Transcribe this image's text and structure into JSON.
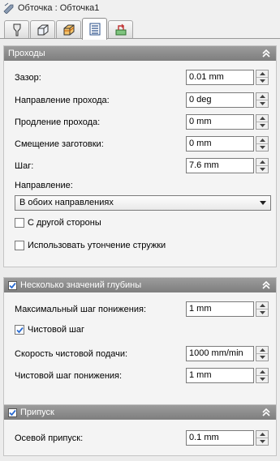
{
  "window": {
    "title": "Обточка : Обточка1"
  },
  "tabs": [
    {
      "name": "tool",
      "icon": "tool-icon"
    },
    {
      "name": "geometry",
      "icon": "geometry-icon"
    },
    {
      "name": "heights",
      "icon": "heights-icon"
    },
    {
      "name": "passes",
      "icon": "passes-icon",
      "active": true
    },
    {
      "name": "linking",
      "icon": "linking-icon"
    }
  ],
  "passes": {
    "title": "Проходы",
    "clearance_label": "Зазор:",
    "clearance_value": "0.01 mm",
    "direction_label": "Направление прохода:",
    "direction_value": "0 deg",
    "extension_label": "Продление прохода:",
    "extension_value": "0 mm",
    "stock_offset_label": "Смещение заготовки:",
    "stock_offset_value": "0 mm",
    "stepover_label": "Шаг:",
    "stepover_value": "7.6 mm",
    "direction_mode_label": "Направление:",
    "direction_mode_value": "В обоих направлениях",
    "other_side_label": "С другой стороны",
    "other_side_checked": false,
    "chip_thinning_label": "Использовать утончение стружки",
    "chip_thinning_checked": false
  },
  "depth": {
    "title": "Несколько значений глубины",
    "enabled": true,
    "max_stepdown_label": "Максимальный шаг понижения:",
    "max_stepdown_value": "1 mm",
    "finishing_step_label": "Чистовой шаг",
    "finishing_step_checked": true,
    "finishing_feed_label": "Скорость чистовой подачи:",
    "finishing_feed_value": "1000 mm/min",
    "finishing_stepdown_label": "Чистовой шаг понижения:",
    "finishing_stepdown_value": "1 mm"
  },
  "stock": {
    "title": "Припуск",
    "enabled": true,
    "axial_label": "Осевой припуск:",
    "axial_value": "0.1 mm"
  },
  "colors": {
    "section_header": "#8a8a8a",
    "panel_bg": "#f4f4f4",
    "check_mark": "#2a6bd1"
  }
}
